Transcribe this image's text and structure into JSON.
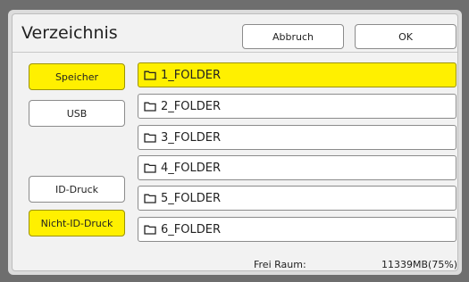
{
  "dialog": {
    "title": "Verzeichnis",
    "cancel_label": "Abbruch",
    "ok_label": "OK"
  },
  "sidebar": {
    "storage_label": "Speicher",
    "usb_label": "USB",
    "id_print_label": "ID-Druck",
    "non_id_print_label": "Nicht-ID-Druck"
  },
  "folders": [
    {
      "name": "1_FOLDER",
      "selected": true
    },
    {
      "name": "2_FOLDER",
      "selected": false
    },
    {
      "name": "3_FOLDER",
      "selected": false
    },
    {
      "name": "4_FOLDER",
      "selected": false
    },
    {
      "name": "5_FOLDER",
      "selected": false
    },
    {
      "name": "6_FOLDER",
      "selected": false
    }
  ],
  "footer": {
    "free_space_label": "Frei Raum:",
    "free_space_value": "11339MB(75%)"
  },
  "colors": {
    "selected_yellow": "#fff000",
    "panel": "#f2f2f2",
    "outer": "#6e6e6e"
  },
  "icons": {
    "folder": "folder-icon"
  }
}
